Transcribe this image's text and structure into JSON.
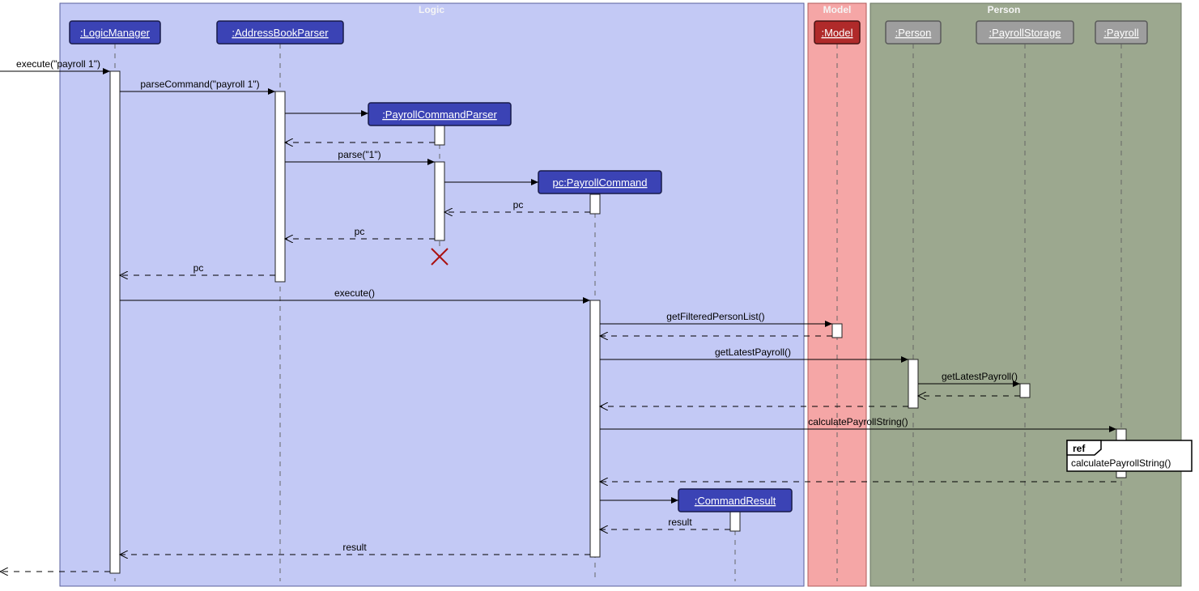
{
  "frames": {
    "logic": "Logic",
    "model": "Model",
    "person": "Person"
  },
  "participants": {
    "logicManager": ":LogicManager",
    "addressBookParser": ":AddressBookParser",
    "payrollCommandParser": ":PayrollCommandParser",
    "payrollCommand": "pc:PayrollCommand",
    "model": ":Model",
    "person": ":Person",
    "payrollStorage": ":PayrollStorage",
    "payroll": ":Payroll",
    "commandResult": ":CommandResult"
  },
  "messages": {
    "m1": "execute(\"payroll 1\")",
    "m2": "parseCommand(\"payroll 1\")",
    "m3": "parse(\"1\")",
    "m4": "pc",
    "m5": "pc",
    "m6": "pc",
    "m7": "execute()",
    "m8": "getFilteredPersonList()",
    "m9": "getLatestPayroll()",
    "m10": "getLatestPayroll()",
    "m11": "calculatePayrollString()",
    "m12": "result",
    "m13": "result"
  },
  "ref": {
    "title": "ref",
    "content": "calculatePayrollString()"
  }
}
